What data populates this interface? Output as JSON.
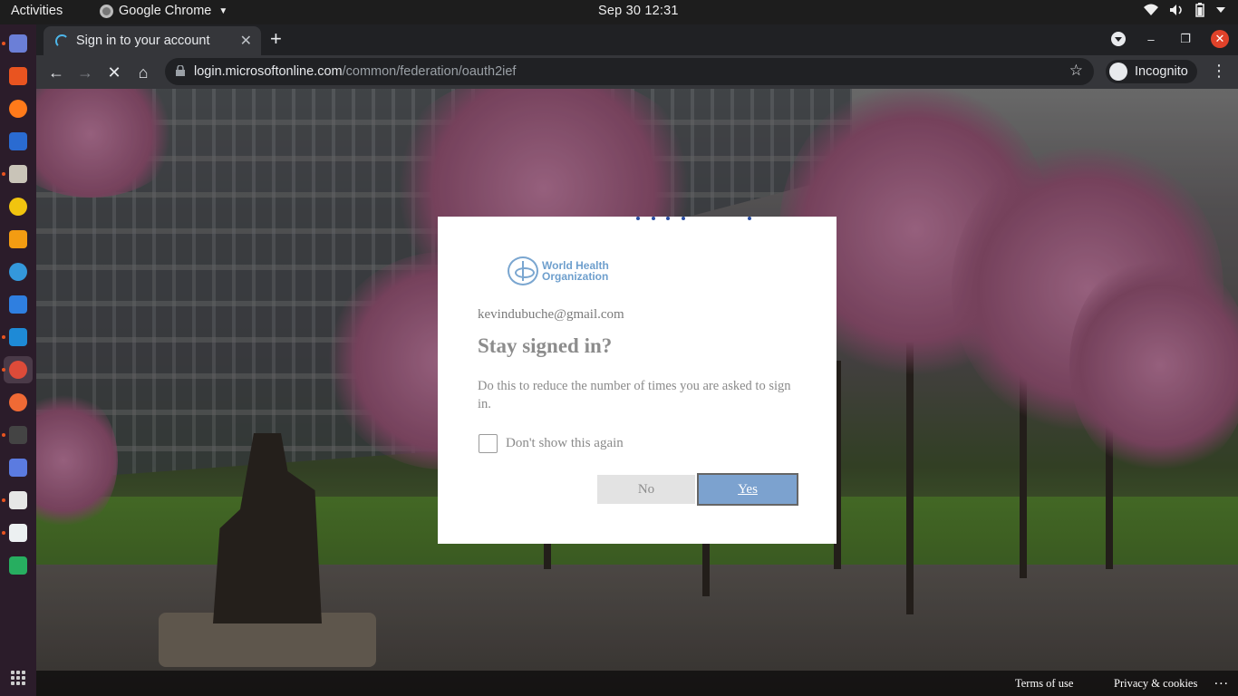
{
  "topbar": {
    "activities": "Activities",
    "app_name": "Google Chrome",
    "clock": "Sep 30  12:31"
  },
  "browser": {
    "tab_title": "Sign in to your account",
    "url_host": "login.microsoftonline.com",
    "url_path": "/common/federation/oauth2ief",
    "incognito_label": "Incognito"
  },
  "dialog": {
    "org_logo_line1": "World Health",
    "org_logo_line2": "Organization",
    "email": "kevindubuche@gmail.com",
    "heading": "Stay signed in?",
    "description": "Do this to reduce the number of times you are asked to sign in.",
    "checkbox_label": "Don't show this again",
    "checkbox_checked": false,
    "no_label": "No",
    "yes_label": "Yes"
  },
  "footer": {
    "terms": "Terms of use",
    "privacy": "Privacy & cookies",
    "more": "..."
  },
  "colors": {
    "accent": "#7ca2cf",
    "dock_bg": "#2b1c2a",
    "topbar_bg": "#1d1d1d",
    "chrome_tabstrip": "#202124",
    "chrome_toolbar": "#35363a"
  }
}
